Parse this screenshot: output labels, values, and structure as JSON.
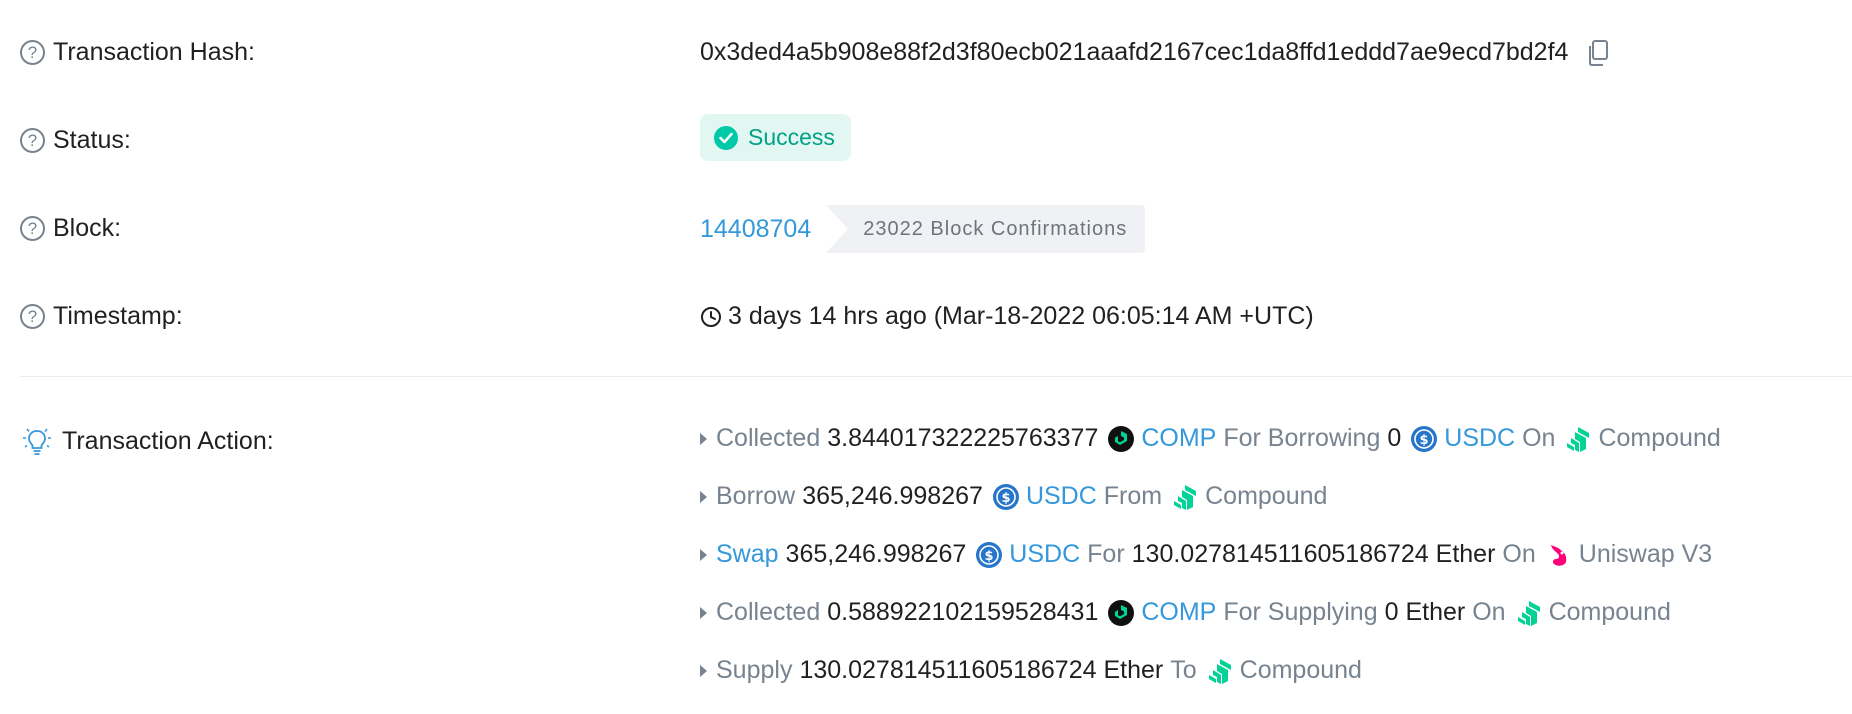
{
  "fields": {
    "hash": {
      "label": "Transaction Hash:",
      "value": "0x3ded4a5b908e88f2d3f80ecb021aaafd2167cec1da8ffd1eddd7ae9ecd7bd2f4"
    },
    "status": {
      "label": "Status:",
      "value": "Success"
    },
    "block": {
      "label": "Block:",
      "number": "14408704",
      "confirmations": "23022 Block Confirmations"
    },
    "timestamp": {
      "label": "Timestamp:",
      "value": "3 days 14 hrs ago (Mar-18-2022 06:05:14 AM +UTC)"
    }
  },
  "action": {
    "label": "Transaction Action:",
    "lines": [
      {
        "verb": "Collected",
        "amount": "3.844017322225763377",
        "token": "COMP",
        "mid": "For Borrowing",
        "amount2": "0",
        "token2": "USDC",
        "prep": "On",
        "protocol": "Compound"
      },
      {
        "verb": "Borrow",
        "amount": "365,246.998267",
        "token": "USDC",
        "prep": "From",
        "protocol": "Compound"
      },
      {
        "verb": "Swap",
        "amount": "365,246.998267",
        "token": "USDC",
        "mid": "For",
        "amount2": "130.027814511605186724 Ether",
        "prep": "On",
        "protocol": "Uniswap V3"
      },
      {
        "verb": "Collected",
        "amount": "0.588922102159528431",
        "token": "COMP",
        "mid": "For Supplying",
        "amount2": "0 Ether",
        "prep": "On",
        "protocol": "Compound"
      },
      {
        "verb": "Supply",
        "amount": "130.027814511605186724 Ether",
        "prep": "To",
        "protocol": "Compound"
      }
    ]
  },
  "colors": {
    "link": "#3498db",
    "success": "#00a186",
    "muted": "#77838f",
    "compound_green": "#00d395"
  }
}
